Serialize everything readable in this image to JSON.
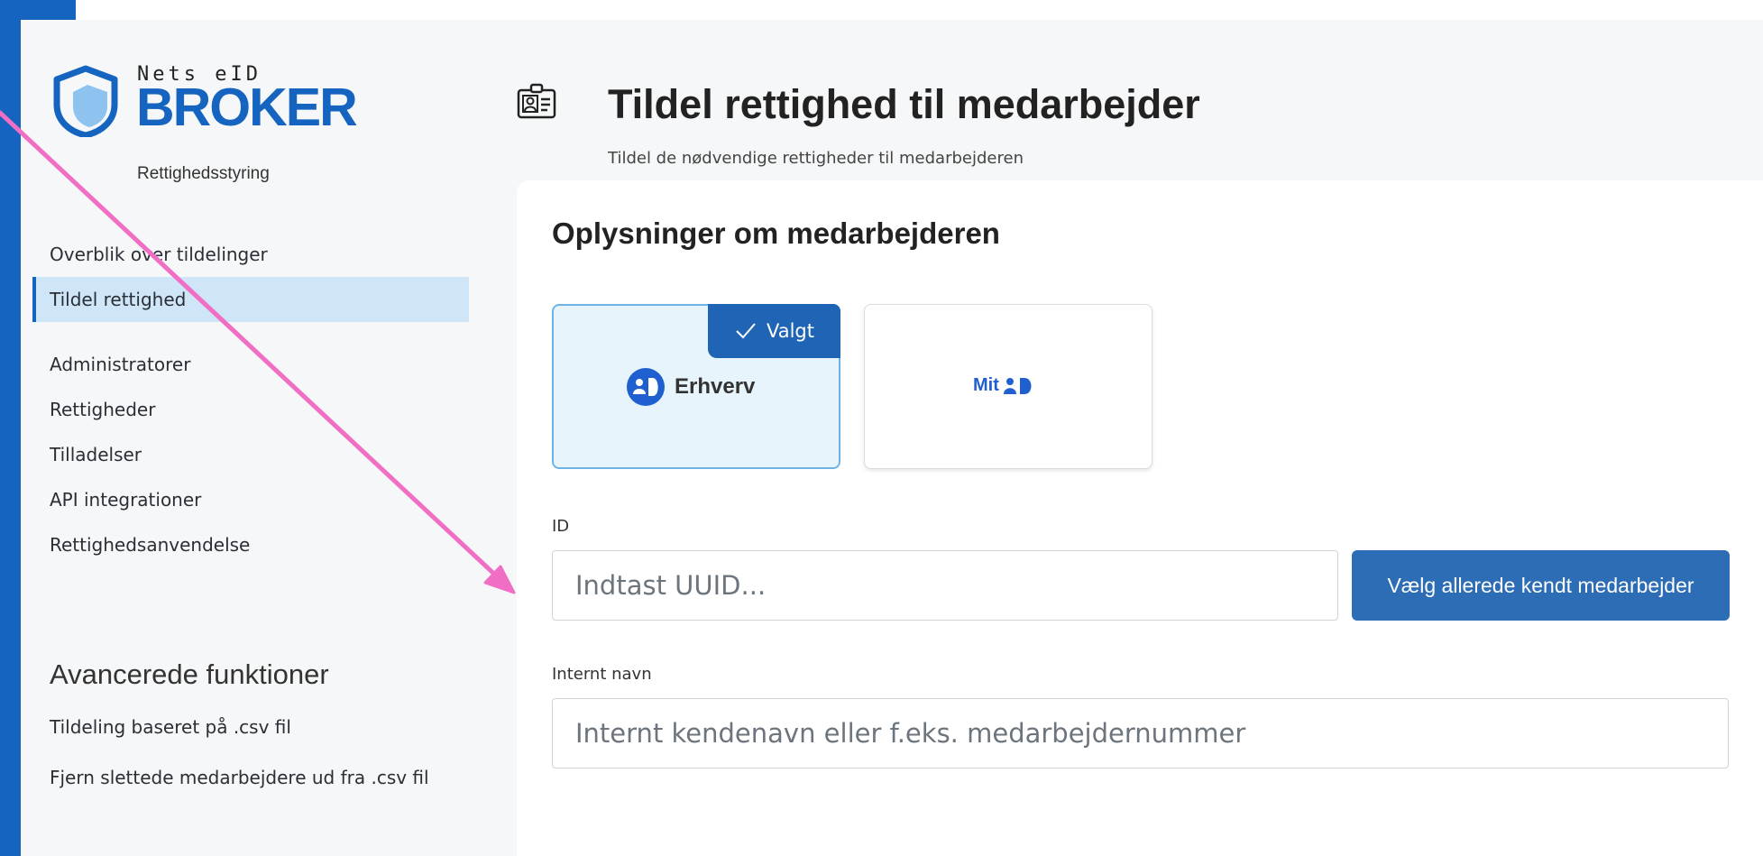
{
  "brand": {
    "nets": "Nets eID",
    "broker": "BROKER",
    "subtitle": "Rettighedsstyring",
    "color": "#1565c0"
  },
  "sidebar": {
    "items": [
      {
        "label": "Overblik over tildelinger",
        "active": false
      },
      {
        "label": "Tildel rettighed",
        "active": true
      },
      {
        "label": "Administratorer",
        "active": false
      },
      {
        "label": "Rettigheder",
        "active": false
      },
      {
        "label": "Tilladelser",
        "active": false
      },
      {
        "label": "API integrationer",
        "active": false
      },
      {
        "label": "Rettighedsanvendelse",
        "active": false
      }
    ],
    "advanced_title": "Avancerede funktioner",
    "advanced_items": [
      {
        "label": "Tildeling baseret på .csv fil"
      },
      {
        "label": "Fjern slettede medarbejdere ud fra .csv fil"
      }
    ]
  },
  "header": {
    "title": "Tildel rettighed til medarbejder",
    "subtitle": "Tildel de nødvendige rettigheder til medarbejderen",
    "icon": "id-card-icon"
  },
  "form": {
    "section_title": "Oplysninger om medarbejderen",
    "options": [
      {
        "label": "Erhverv",
        "selected": true,
        "badge": "Valgt",
        "icon": "mitid-erhverv-icon"
      },
      {
        "label": "Mit",
        "selected": false,
        "icon": "mitid-logo-icon"
      }
    ],
    "id_label": "ID",
    "id_placeholder": "Indtast UUID...",
    "choose_button": "Vælg allerede kendt medarbejder",
    "name_label": "Internt navn",
    "name_placeholder": "Internt kendenavn eller f.eks. medarbejdernummer"
  },
  "colors": {
    "accent": "#1565c0",
    "button": "#2c6db5",
    "annotation_arrow": "#f06ec4"
  }
}
